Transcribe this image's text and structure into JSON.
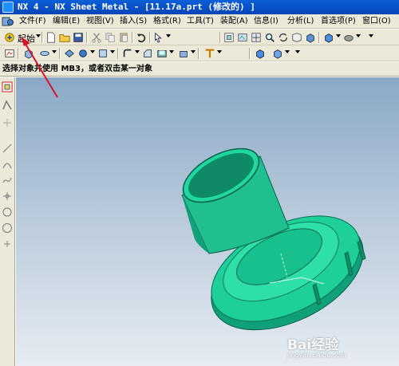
{
  "window": {
    "title": "NX 4 - NX Sheet Metal - [11.17a.prt  (修改的) ]"
  },
  "menu": [
    {
      "id": "file",
      "label": "文件(F)"
    },
    {
      "id": "edit",
      "label": "编辑(E)"
    },
    {
      "id": "view",
      "label": "视图(V)"
    },
    {
      "id": "insert",
      "label": "插入(S)"
    },
    {
      "id": "format",
      "label": "格式(R)"
    },
    {
      "id": "tools",
      "label": "工具(T)"
    },
    {
      "id": "assembly",
      "label": "装配(A)"
    },
    {
      "id": "info",
      "label": "信息(I)"
    },
    {
      "id": "analysis",
      "label": "分析(L)"
    },
    {
      "id": "preferences",
      "label": "首选项(P)"
    },
    {
      "id": "window",
      "label": "窗口(O)"
    }
  ],
  "toolbar": {
    "start_label": "起始"
  },
  "cue": {
    "text": "选择对象并使用 MB3，或者双击某一对象"
  },
  "watermark": {
    "brand": "Bai经验",
    "sub": "jingyan.baidu.com"
  },
  "colors": {
    "title_bar": "#0a5fd8",
    "chrome": "#ece9d8",
    "model_green": "#1fcf9a",
    "annotation_arrow": "#d8102a"
  }
}
